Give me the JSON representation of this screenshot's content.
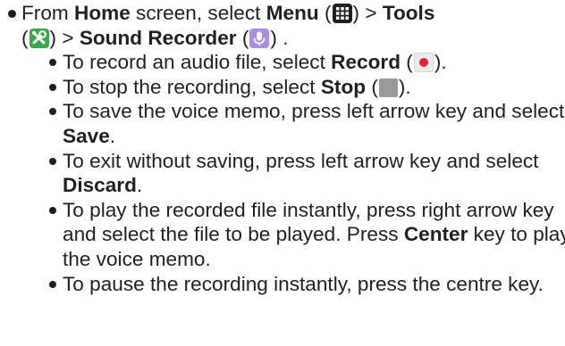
{
  "step": {
    "t1": "From ",
    "home": "Home",
    "t2": " screen, select ",
    "menu": "Menu",
    "t3": " (",
    "t4": ") > ",
    "tools": "Tools",
    "t5": "(",
    "t6": ") > ",
    "sound_recorder": "Sound Recorder",
    "t7": " (",
    "t8": ") ."
  },
  "bullets": {
    "record": {
      "pre": "To record an audio file, select ",
      "bold": "Record",
      "mid": " (",
      "post": ")."
    },
    "stop": {
      "pre": "To stop the recording, select ",
      "bold": "Stop",
      "mid": " (",
      "post": ")."
    },
    "save": {
      "pre": "To save the voice memo, press left arrow key and select ",
      "bold": "Save",
      "post": "."
    },
    "discard": {
      "pre": "To exit without saving, press left arrow key and select ",
      "bold": "Discard",
      "post": "."
    },
    "play": {
      "pre": "To play the recorded file instantly, press right arrow key and select the file to be played. Press ",
      "bold": "Center",
      "post": " key to play the voice memo."
    },
    "pause": {
      "text": "To pause the recording instantly, press the centre key."
    }
  },
  "icons": {
    "menu": "menu-grid-icon",
    "tools": "tools-icon",
    "sound_recorder": "microphone-icon",
    "record": "record-icon",
    "stop": "stop-icon"
  },
  "colors": {
    "text": "#231f20",
    "tools_icon": "#3aa84a",
    "mic_icon": "#a98ee6",
    "record_dot": "#e5243b",
    "stop_square": "#9a9a9a"
  }
}
